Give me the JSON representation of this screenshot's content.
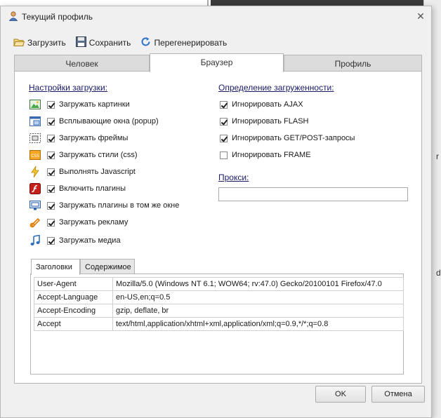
{
  "window": {
    "title": "Текущий профиль"
  },
  "toolbar": {
    "load": "Загрузить",
    "save": "Сохранить",
    "regenerate": "Перегенерировать"
  },
  "tabs": [
    {
      "label": "Человек"
    },
    {
      "label": "Браузер"
    },
    {
      "label": "Профиль"
    }
  ],
  "load_settings": {
    "title": "Настройки загрузки:",
    "items": [
      {
        "label": "Загружать картинки",
        "checked": true,
        "icon": "image-icon"
      },
      {
        "label": "Всплывающие окна (popup)",
        "checked": true,
        "icon": "popup-window-icon"
      },
      {
        "label": "Загружать фреймы",
        "checked": true,
        "icon": "frame-icon"
      },
      {
        "label": "Загружать стили (css)",
        "checked": true,
        "icon": "css-icon"
      },
      {
        "label": "Выполнять Javascript",
        "checked": true,
        "icon": "lightning-icon"
      },
      {
        "label": "Включить плагины",
        "checked": true,
        "icon": "flash-plugin-icon"
      },
      {
        "label": "Загружать плагины в том же окне",
        "checked": true,
        "icon": "plugin-window-icon"
      },
      {
        "label": "Загружать рекламу",
        "checked": true,
        "icon": "advertising-icon"
      },
      {
        "label": "Загружать медиа",
        "checked": true,
        "icon": "music-note-icon"
      }
    ]
  },
  "load_detection": {
    "title": "Определение загруженности:",
    "items": [
      {
        "label": "Игнорировать AJAX",
        "checked": true
      },
      {
        "label": "Игнорировать FLASH",
        "checked": true
      },
      {
        "label": "Игнорировать GET/POST-запросы",
        "checked": true
      },
      {
        "label": "Игнорировать FRAME",
        "checked": false
      }
    ]
  },
  "proxy": {
    "label": "Прокси:",
    "value": ""
  },
  "subtabs": [
    {
      "label": "Заголовки"
    },
    {
      "label": "Содержимое"
    }
  ],
  "headers": [
    {
      "key": "User-Agent",
      "value": "Mozilla/5.0 (Windows NT 6.1; WOW64; rv:47.0) Gecko/20100101 Firefox/47.0"
    },
    {
      "key": "Accept-Language",
      "value": "en-US,en;q=0.5"
    },
    {
      "key": "Accept-Encoding",
      "value": "gzip, deflate, br"
    },
    {
      "key": "Accept",
      "value": "text/html,application/xhtml+xml,application/xml;q=0.9,*/*;q=0.8"
    }
  ],
  "buttons": {
    "ok": "OK",
    "cancel": "Отмена"
  },
  "background": {
    "edge_text_1": "r",
    "edge_text_2": "d"
  }
}
